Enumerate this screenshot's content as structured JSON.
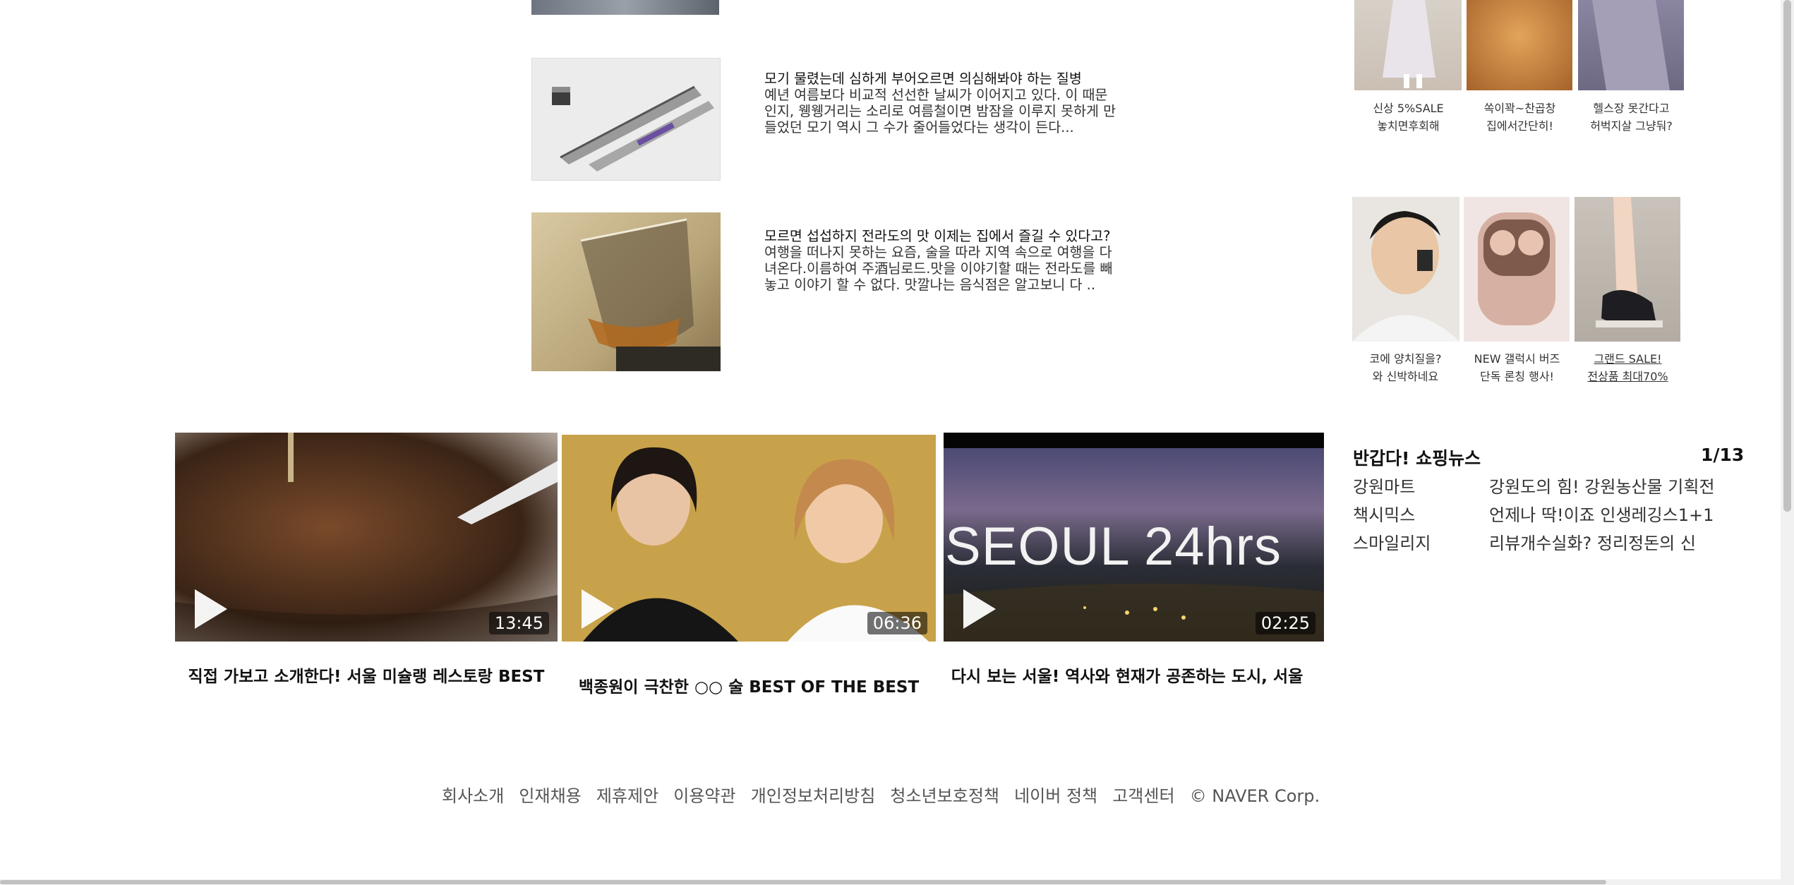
{
  "articles": [
    {
      "title": "모기 물렸는데 심하게 부어오르면 의심해봐야 하는 질병",
      "excerpt": "예년 여름보다 비교적 선선한 날씨가 이어지고 있다. 이 때문인지, 웽웽거리는 소리로 여름철이면 밤잠을 이루지 못하게 만들었던 모기 역시 그 수가 줄어들었다는 생각이 든다..."
    },
    {
      "title": "모르면 섭섭하지 전라도의 맛 이제는 집에서 즐길 수 있다고?",
      "excerpt": "여행을 떠나지 못하는 요즘, 술을 따라 지역 속으로 여행을 다녀온다.이름하여 주酒님로드.맛을 이야기할 때는 전라도를 빼놓고 이야기 할 수 없다. 맛깔나는 음식점은 알고보니 다 .."
    }
  ],
  "shopping_ads": {
    "row1": [
      {
        "caption_l1": "신상 5%SALE",
        "caption_l2": "놓치면후회해"
      },
      {
        "caption_l1": "쏙이꽉~찬곱창",
        "caption_l2": "집에서간단히!"
      },
      {
        "caption_l1": "헬스장 못간다고",
        "caption_l2": "허벅지살 그냥둬?"
      }
    ],
    "row2": [
      {
        "caption_l1": "코에 양치질을?",
        "caption_l2": "와 신박하네요"
      },
      {
        "caption_l1": "NEW 갤럭시 버즈",
        "caption_l2": "단독 론칭 행사!"
      },
      {
        "caption_l1": "그랜드 SALE!",
        "caption_l2": "전상품 최대70%"
      }
    ]
  },
  "videos": [
    {
      "duration": "13:45",
      "title": "직접 가보고 소개한다! 서울 미슐랭 레스토랑 BEST"
    },
    {
      "duration": "06:36",
      "title": "백종원이 극찬한 ○○ 술 BEST OF THE BEST"
    },
    {
      "duration": "02:25",
      "overlay": "SEOUL 24hrs",
      "title": "다시 보는 서울! 역사와 현재가 공존하는 도시, 서울"
    }
  ],
  "shopping_news": {
    "heading": "반갑다! 쇼핑뉴스",
    "page": "1/13",
    "items": [
      {
        "store": "강원마트",
        "text": "강원도의 힘! 강원농산물 기획전"
      },
      {
        "store": "책시믹스",
        "text": "언제나 딱!이죠 인생레깅스1+1"
      },
      {
        "store": "스마일리지",
        "text": "리뷰개수실화? 정리정돈의 신"
      }
    ]
  },
  "footer": {
    "links": [
      "회사소개",
      "인재채용",
      "제휴제안",
      "이용약관",
      "개인정보처리방침",
      "청소년보호정책",
      "네이버 정책",
      "고객센터"
    ],
    "copyright": "© NAVER Corp."
  }
}
